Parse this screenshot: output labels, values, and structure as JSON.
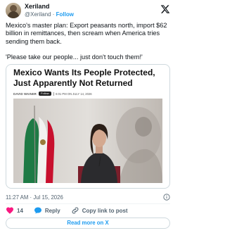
{
  "author": {
    "name": "Xeriland",
    "handle": "@Xeriland",
    "dot": "·",
    "follow_label": "Follow"
  },
  "tweet": {
    "paragraph1": "Mexico's master plan: Export peasants north, import $62 billion in remittances, then scream when America tries sending them back.",
    "paragraph2": "'Please take our people... just don't touch them!'"
  },
  "card": {
    "title": "Mexico Wants Its People Protected, Just Apparently Not Returned",
    "author": "DAVID WAINER",
    "follow_label": "Follow",
    "timestamp": "6:01 PM ON JULY 14, 2026"
  },
  "meta": {
    "time": "11:27 AM",
    "dot": "·",
    "date": "Jul 15, 2026"
  },
  "actions": {
    "like_count": "14",
    "reply_label": "Reply",
    "copy_label": "Copy link to post"
  },
  "read_more_label": "Read more on X",
  "colors": {
    "accent": "#1d9bf0",
    "like": "#f91880",
    "text": "#0f1419",
    "muted": "#536471",
    "border": "#cfd9de"
  },
  "icons": [
    "x-logo-icon",
    "heart-icon",
    "reply-icon",
    "link-icon",
    "info-icon"
  ]
}
